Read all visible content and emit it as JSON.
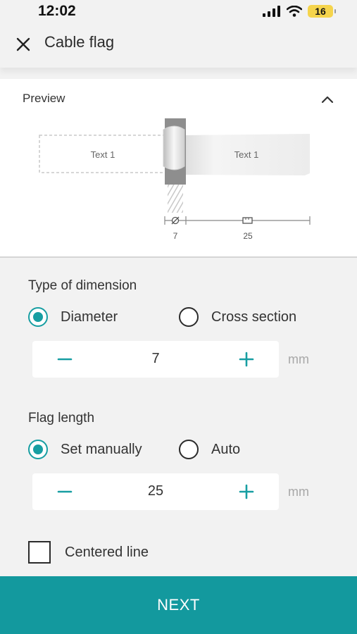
{
  "status_bar": {
    "time": "12:02",
    "battery": "16",
    "signal_icon": "signal-bars-icon",
    "wifi_icon": "wifi-icon"
  },
  "header": {
    "title": "Cable flag",
    "close_icon": "close-icon"
  },
  "preview": {
    "label": "Preview",
    "toggle_icon": "chevron-up-icon",
    "left_flag_text": "Text 1",
    "right_flag_text": "Text 1",
    "diameter_value": "7",
    "length_value": "25"
  },
  "dimension": {
    "title": "Type of dimension",
    "options": [
      {
        "label": "Diameter",
        "selected": true
      },
      {
        "label": "Cross section",
        "selected": false
      }
    ],
    "value": "7",
    "unit": "mm"
  },
  "flag_length": {
    "title": "Flag length",
    "options": [
      {
        "label": "Set manually",
        "selected": true
      },
      {
        "label": "Auto",
        "selected": false
      }
    ],
    "value": "25",
    "unit": "mm"
  },
  "centered_line": {
    "label": "Centered line",
    "checked": false
  },
  "next_button": {
    "label": "NEXT"
  },
  "colors": {
    "accent": "#13999e",
    "background": "#f2f2f2",
    "card": "#ffffff"
  }
}
